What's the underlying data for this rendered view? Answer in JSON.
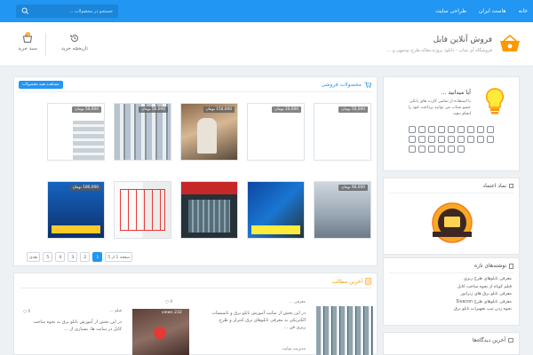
{
  "topbar": {
    "nav": [
      "خانه",
      "هاست ایران",
      "طراحی سایت"
    ],
    "search_placeholder": "جستجو در محصولات ..."
  },
  "header": {
    "title": "فروش آنلاین فایل",
    "subtitle": "فروشگاه آی شاپ - دانلود پروژه،مقاله،طرح توجیهی و ...",
    "history_label": "تاریخچه خرید",
    "cart_label": "سبد خرید",
    "cart_count": "0"
  },
  "products": {
    "title": "محصولات فروشی",
    "all_button": "مشاهده همه محصولات",
    "items": [
      {
        "price": "50,000 تومان"
      },
      {
        "price": "10,000 تومان"
      },
      {
        "price": "150,000 تومان"
      },
      {
        "price": "50,000 تومان"
      },
      {
        "price": "50,000 تومان"
      },
      {
        "price": "90,000 تومان"
      },
      {
        "price": ""
      },
      {
        "price": ""
      },
      {
        "price": ""
      },
      {
        "price": "180,000 تومان"
      }
    ],
    "pager": {
      "current": "صفحه 1 از 5",
      "pages": [
        "1",
        "2",
        "3",
        "4",
        "5"
      ],
      "next": "بعدی"
    }
  },
  "latest": {
    "title": "آخرین مطالب",
    "articles": [
      {
        "title": "معرفی ...",
        "comments": "0",
        "text": "در این بخش از سایت آموزش تابلو برق و تاسیسات الکتریکی به معرفی تابلوهای برق کنترلر و طرح ریزی فن ...",
        "views": "232 views",
        "author": "مدیریت سایت",
        "more": "ادامه مطلب"
      },
      {
        "title": "فیلم ...",
        "comments": "0",
        "text": "در این بخش از آموزش تابلو برق به نحوه ساخت کابل در سایت ها، بسیاری از ...",
        "views": "",
        "author": "",
        "more": "ادامه مطلب"
      }
    ]
  },
  "sidebar": {
    "know": {
      "title": "آیا میدانید ...",
      "text": "با استفاده از تمامی کارت های بانکی عضو شتاب می توانید پرداخت خود را انجام دهید."
    },
    "trust": {
      "title": "نماد اعتماد"
    },
    "tags": {
      "title": "نوشته‌های تازه",
      "items": [
        "معرفی تابلوهای طرح ریزی",
        "فیلم کوتاه از نحوه ساخت کابل",
        "معرفی تابلو برق های ژنراتور",
        "معرفی تابلوهای طرح Sivacon",
        "نحوه زدن تیپ تجهیزات تابلو برق"
      ]
    },
    "recent": {
      "title": "آخرین دیدگاه‌ها"
    }
  },
  "colors": {
    "primary": "#2196f3",
    "accent": "#ff9800",
    "bg": "#eef1f4"
  }
}
